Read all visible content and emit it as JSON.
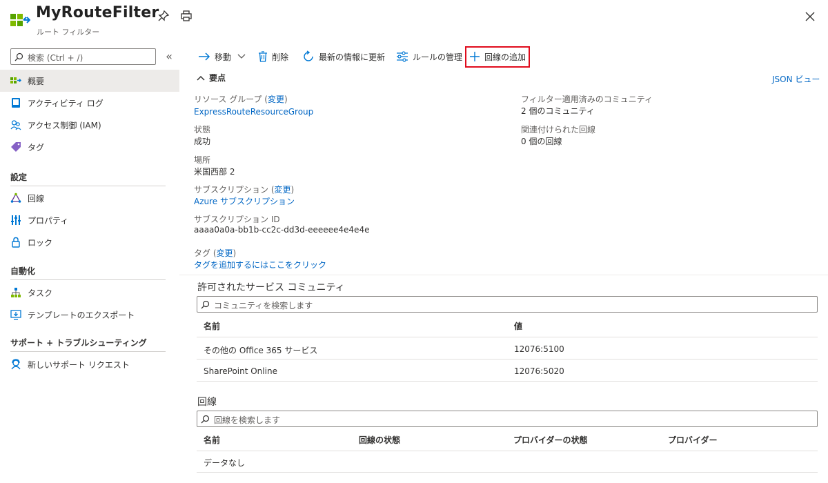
{
  "header": {
    "title": "MyRouteFilter",
    "subtitle": "ルート フィルター"
  },
  "sidebar": {
    "search_placeholder": "検索 (Ctrl + /)",
    "collapse": "«",
    "items": [
      {
        "label": "概要",
        "icon": "route-filter-icon",
        "active": true
      },
      {
        "label": "アクティビティ ログ",
        "icon": "activity-log-icon"
      },
      {
        "label": "アクセス制御 (IAM)",
        "icon": "access-control-icon"
      },
      {
        "label": "タグ",
        "icon": "tag-icon"
      }
    ],
    "sections": [
      {
        "title": "設定",
        "items": [
          {
            "label": "回線",
            "icon": "circuit-icon"
          },
          {
            "label": "プロパティ",
            "icon": "properties-icon"
          },
          {
            "label": "ロック",
            "icon": "lock-icon"
          }
        ]
      },
      {
        "title": "自動化",
        "items": [
          {
            "label": "タスク",
            "icon": "tasks-icon"
          },
          {
            "label": "テンプレートのエクスポート",
            "icon": "export-template-icon"
          }
        ]
      },
      {
        "title": "サポート + トラブルシューティング",
        "items": [
          {
            "label": "新しいサポート リクエスト",
            "icon": "support-request-icon"
          }
        ]
      }
    ]
  },
  "toolbar": {
    "move": "移動",
    "delete": "削除",
    "refresh": "最新の情報に更新",
    "manage_rules": "ルールの管理",
    "add_circuit": "回線の追加"
  },
  "essentials": {
    "header": "要点",
    "json_view": "JSON ビュー",
    "resource_group_label": "リソース グループ (",
    "change": "変更",
    "close_paren": ")",
    "resource_group_value": "ExpressRouteResourceGroup",
    "status_label": "状態",
    "status_value": "成功",
    "location_label": "場所",
    "location_value": "米国西部 2",
    "subscription_label": "サブスクリプション (",
    "subscription_value": "Azure サブスクリプション",
    "subscription_id_label": "サブスクリプション ID",
    "subscription_id_value": "aaaa0a0a-bb1b-cc2c-dd3d-eeeeee4e4e4e",
    "tags_label": "タグ (",
    "tags_value": "タグを追加するにはここをクリック",
    "communities_label": "フィルター適用済みのコミュニティ",
    "communities_value": "2 個のコミュニティ",
    "circuits_label": "関連付けられた回線",
    "circuits_value": "0 個の回線"
  },
  "communities_table": {
    "title": "許可されたサービス コミュニティ",
    "search_placeholder": "コミュニティを検索します",
    "columns": [
      "名前",
      "値"
    ],
    "rows": [
      [
        "その他の Office 365 サービス",
        "12076:5100"
      ],
      [
        "SharePoint Online",
        "12076:5020"
      ]
    ]
  },
  "circuits_table": {
    "title": "回線",
    "search_placeholder": "回線を検索します",
    "columns": [
      "名前",
      "回線の状態",
      "プロバイダーの状態",
      "プロバイダー"
    ],
    "empty": "データなし"
  },
  "colors": {
    "link": "#0066c4",
    "highlight": "#e00b1c",
    "active_bg": "#edebe9"
  }
}
